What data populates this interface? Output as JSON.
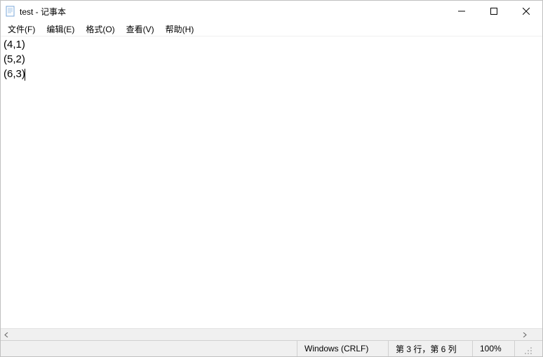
{
  "titlebar": {
    "title": "test - 记事本"
  },
  "menubar": {
    "items": [
      {
        "label": "文件(F)"
      },
      {
        "label": "编辑(E)"
      },
      {
        "label": "格式(O)"
      },
      {
        "label": "查看(V)"
      },
      {
        "label": "帮助(H)"
      }
    ]
  },
  "editor": {
    "content": "(4,1)\n(5,2)\n(6,3)"
  },
  "statusbar": {
    "encoding": "Windows (CRLF)",
    "position": "第 3 行，第 6 列",
    "zoom": "100%"
  }
}
